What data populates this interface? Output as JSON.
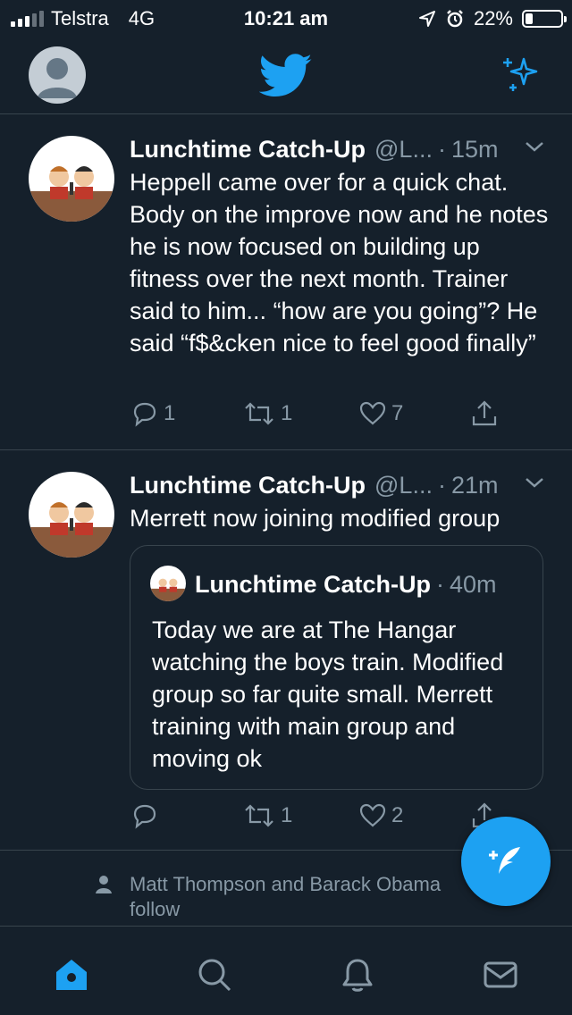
{
  "status_bar": {
    "carrier": "Telstra",
    "network": "4G",
    "time": "10:21 am",
    "battery": "22%",
    "battery_level": 0.22
  },
  "nav": {
    "avatar_icon": "profile-avatar",
    "logo_icon": "twitter-bird-icon",
    "sparkle_icon": "sparkle-icon"
  },
  "tweets": [
    {
      "name": "Lunchtime Catch-Up",
      "handle": "@L...",
      "time": "15m",
      "text": "Heppell came over for a quick chat. Body on the improve now and he notes he is now focused on building up fitness over the next month. Trainer said to him... “how are you going”? He said “f$&cken nice to feel good finally”",
      "replies": "1",
      "retweets": "1",
      "likes": "7"
    },
    {
      "name": "Lunchtime Catch-Up",
      "handle": "@L...",
      "time": "21m",
      "text": "Merrett now joining modified group",
      "replies": "",
      "retweets": "1",
      "likes": "2",
      "quote": {
        "name": "Lunchtime Catch-Up",
        "time": "40m",
        "text": "Today we are at The Hangar watching the boys train. Modified group so far quite small. Merrett training with main group and moving ok"
      }
    }
  ],
  "follow_note": "Matt Thompson and Barack Obama follow",
  "tabs": [
    "home-icon",
    "search-icon",
    "notifications-icon",
    "messages-icon"
  ],
  "colors": {
    "background": "#15202b",
    "accent": "#1da1f2",
    "muted": "#8899a6",
    "divider": "#38444d"
  }
}
